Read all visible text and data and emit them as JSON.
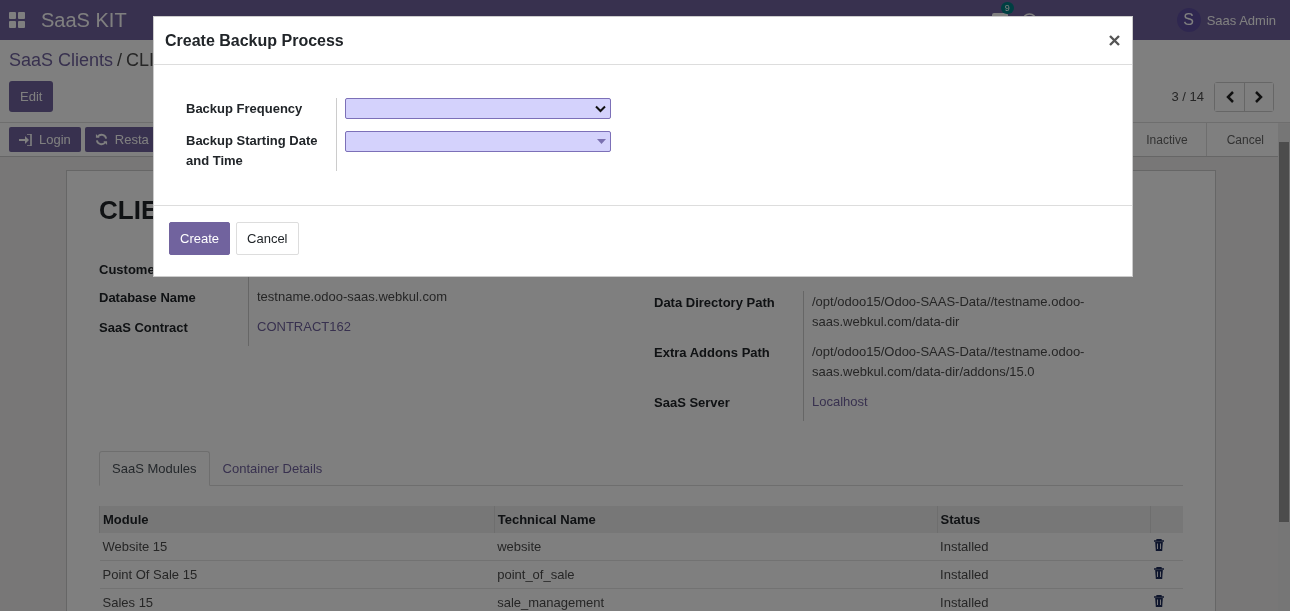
{
  "navbar": {
    "app_name": "SaaS KIT",
    "messages_badge": "9",
    "user": {
      "initial": "S",
      "name": "Saas Admin"
    }
  },
  "breadcrumb": [
    "SaaS Clients",
    "CLI"
  ],
  "breadcrumb_separator": "/",
  "edit_button": "Edit",
  "pager": "3 / 14",
  "action_buttons": [
    {
      "label": "Login",
      "kind": "login"
    },
    {
      "label": "Resta",
      "kind": "restart"
    }
  ],
  "stages": [
    "Inactive",
    "Cancel"
  ],
  "record_title": "CLIE",
  "left_fields": [
    {
      "label": "Custome"
    },
    {
      "label": "Database Name",
      "value": "testname.odoo-saas.webkul.com",
      "link": false
    },
    {
      "label": "SaaS Contract",
      "value": "CONTRACT162",
      "link": true
    }
  ],
  "right_fields": [
    {
      "label": "Data Directory Path",
      "value": "/opt/odoo15/Odoo-SAAS-Data//testname.odoo-saas.webkul.com/data-dir",
      "link": false
    },
    {
      "label": "Extra Addons Path",
      "value": "/opt/odoo15/Odoo-SAAS-Data//testname.odoo-saas.webkul.com/data-dir/addons/15.0",
      "link": false
    },
    {
      "label": "SaaS Server",
      "value": "Localhost",
      "link": true
    }
  ],
  "tabs": [
    {
      "label": "SaaS Modules",
      "selected": true
    },
    {
      "label": "Container Details",
      "selected": false
    }
  ],
  "table": {
    "columns": [
      "Module",
      "Technical Name",
      "Status"
    ],
    "rows": [
      {
        "module": "Website 15",
        "technical_name": "website",
        "status": "Installed"
      },
      {
        "module": "Point Of Sale 15",
        "technical_name": "point_of_sale",
        "status": "Installed"
      },
      {
        "module": "Sales 15",
        "technical_name": "sale_management",
        "status": "Installed"
      }
    ]
  },
  "dialog": {
    "title": "Create Backup Process",
    "fields": [
      {
        "label": "Backup Frequency",
        "kind": "select"
      },
      {
        "label": "Backup Starting Date and Time",
        "kind": "datetime"
      }
    ],
    "buttons": [
      {
        "label": "Create",
        "kind": "primary"
      },
      {
        "label": "Cancel",
        "kind": "secondary"
      }
    ]
  }
}
